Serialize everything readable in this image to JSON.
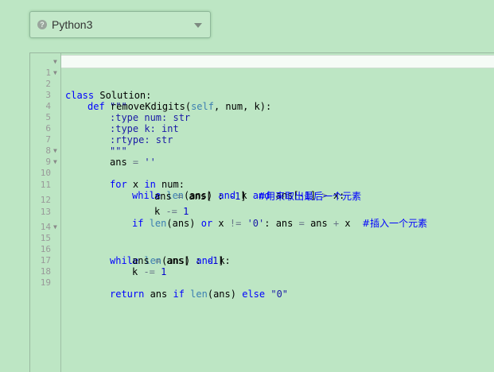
{
  "language_select": {
    "value": "Python3",
    "icon": "help-icon"
  },
  "editor": {
    "lines": [
      {
        "n": "1",
        "fold": true
      },
      {
        "n": "2",
        "fold": true
      },
      {
        "n": "3",
        "fold": false
      },
      {
        "n": "4",
        "fold": false
      },
      {
        "n": "5",
        "fold": false
      },
      {
        "n": "6",
        "fold": false
      },
      {
        "n": "7",
        "fold": false
      },
      {
        "n": "8",
        "fold": false
      },
      {
        "n": "9",
        "fold": true
      },
      {
        "n": "10",
        "fold": true
      },
      {
        "n": "11",
        "fold": false
      },
      {
        "n": "12",
        "fold": false
      },
      {
        "n": "13",
        "fold": false
      },
      {
        "n": "14",
        "fold": false
      },
      {
        "n": "15",
        "fold": true
      },
      {
        "n": "16",
        "fold": false
      },
      {
        "n": "17",
        "fold": false
      },
      {
        "n": "18",
        "fold": false
      },
      {
        "n": "19",
        "fold": false
      }
    ],
    "tokens": {
      "l1": [
        "class",
        " Solution:"
      ],
      "l2": [
        "def",
        " removeKdigits(",
        "self",
        ", num, k):"
      ],
      "l3": [
        "\"\"\""
      ],
      "l4": [
        ":type num: str"
      ],
      "l5": [
        ":type k: int"
      ],
      "l6": [
        ":rtype: str"
      ],
      "l7": [
        "\"\"\""
      ],
      "l8": [
        "ans ",
        "=",
        " ",
        "''"
      ],
      "l9": [
        "for",
        " x ",
        "in",
        " num:"
      ],
      "l10": [
        "while",
        " ",
        "len",
        "(ans) ",
        "and",
        " k ",
        "and",
        " ans[",
        "-1",
        "] ",
        ">",
        " x:"
      ],
      "l11": [
        "ans ",
        "=",
        " ans[ : ",
        "-1",
        "]  ",
        "#用来取出最后一个元素"
      ],
      "l12": [
        "k ",
        "-=",
        " ",
        "1"
      ],
      "l13": [
        "if",
        " ",
        "len",
        "(ans) ",
        "or",
        " x ",
        "!=",
        " ",
        "'0'",
        ": ans ",
        "=",
        " ans ",
        "+",
        " x  ",
        "#插入一个元素"
      ],
      "l15": [
        "while",
        " ",
        "len",
        "(ans) ",
        "and",
        " k:"
      ],
      "l16": [
        "ans ",
        "=",
        " ans[ : ",
        "-1",
        "]"
      ],
      "l17": [
        "k ",
        "-=",
        " ",
        "1"
      ],
      "l19": [
        "return",
        " ans ",
        "if",
        " ",
        "len",
        "(ans) ",
        "else",
        " ",
        "\"0\""
      ]
    }
  }
}
